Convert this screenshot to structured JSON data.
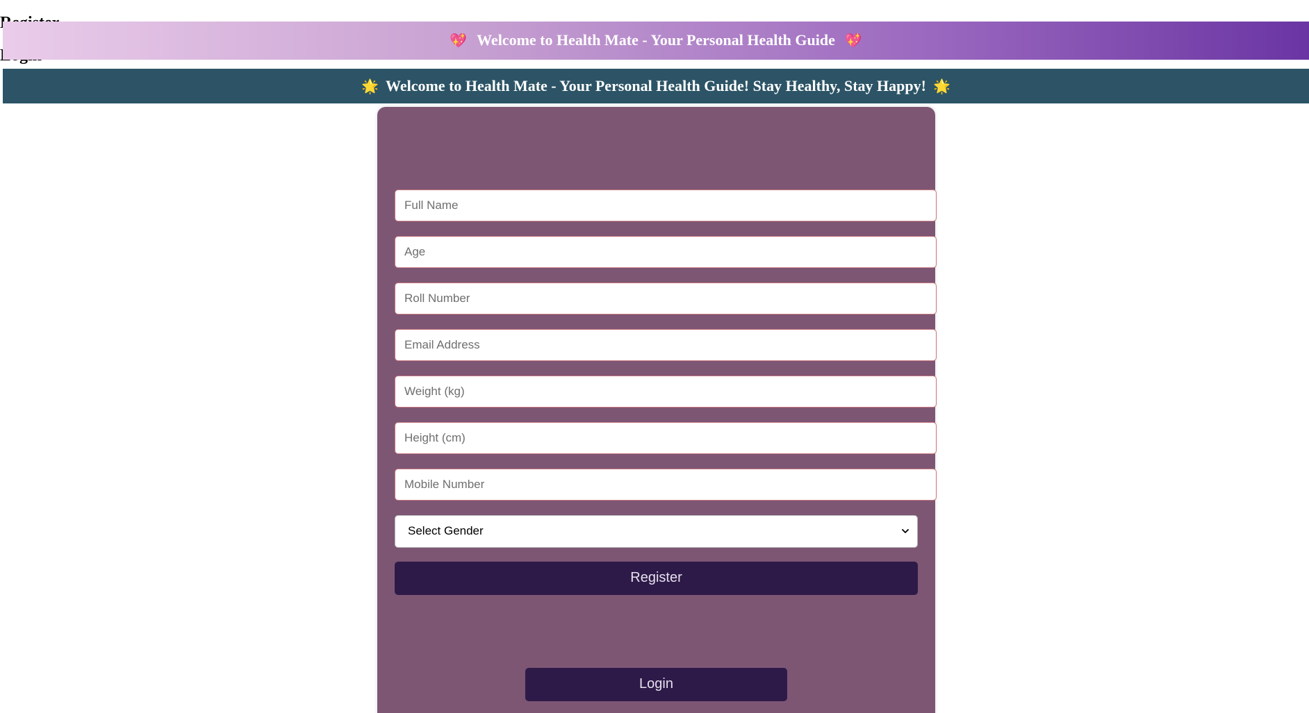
{
  "banner": {
    "left_icon": "💖",
    "text": "Welcome to Health Mate - Your Personal Health Guide",
    "right_icon": "💖",
    "icon_name": "sparkling-heart-icon"
  },
  "marquee": {
    "left_icon": "🌟",
    "text": "Welcome to Health Mate - Your Personal Health Guide! Stay Healthy, Stay Happy!",
    "right_icon": "🌟",
    "icon_name": "glowing-star-icon"
  },
  "register": {
    "title": "Register",
    "fields": {
      "full_name": "Full Name",
      "age": "Age",
      "roll_number": "Roll Number",
      "email": "Email Address",
      "weight": "Weight (kg)",
      "height": "Height (cm)",
      "mobile": "Mobile Number"
    },
    "gender_select": "Select Gender",
    "button": "Register"
  },
  "login": {
    "title": "Login",
    "button": "Login"
  },
  "colors": {
    "card": "#7d5674",
    "button": "#2d1a48",
    "marquee": "#2c5466",
    "banner_start": "#eaccea",
    "banner_end": "#6a35a3"
  }
}
